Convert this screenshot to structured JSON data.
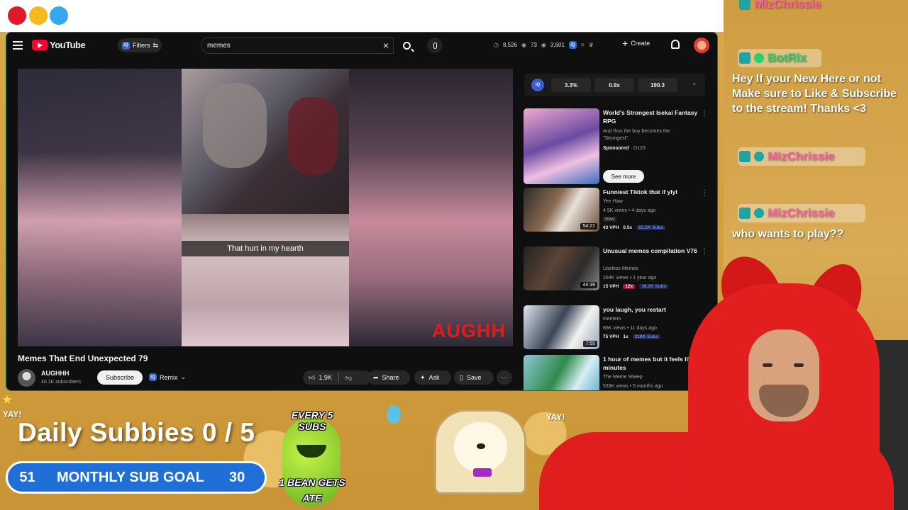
{
  "window_controls": [
    "red",
    "yellow",
    "blue"
  ],
  "youtube": {
    "logo_text": "YouTube",
    "filters_label": "Filters",
    "search": {
      "value": "memes"
    },
    "stats": {
      "views": "8,526",
      "watching": "73",
      "viewers": "3,601"
    },
    "create_label": "Create",
    "player": {
      "caption": "That hurt in my hearth",
      "watermark": "AUGHH"
    },
    "video_title": "Memes That End Unexpected 79",
    "channel": {
      "name": "AUGHHH",
      "subs": "40.1K subscribers"
    },
    "subscribe_label": "Subscribe",
    "remix_label": "Remix",
    "actions": {
      "likes": "1.9K",
      "share": "Share",
      "ask": "Ask",
      "save": "Save"
    },
    "iq_stats": [
      "3.3%",
      "0.9x",
      "190.3"
    ],
    "recommendations": [
      {
        "title": "World's Strongest Isekai Fantasy RPG",
        "line1": "And thus the boy becomes the \"Strongest\".",
        "sponsored": "Sponsored",
        "sponsor": "G123",
        "button": "See more"
      },
      {
        "title": "Funniest Tiktok that if ylyl",
        "channel": "Yee Haw",
        "meta": "4.5K views • 4 days ago",
        "tag": "New",
        "duration": "54:21",
        "vph": "43 VPH",
        "mult": "0.5x",
        "subs": "23.5K Subs"
      },
      {
        "title": "Unusual memes compilation V76",
        "channel": "Useless Memes",
        "meta": "164K views • 1 year ago",
        "duration": "44:39",
        "vph": "15 VPH",
        "mult": "12x",
        "subs": "16.2K Subs"
      },
      {
        "title": "you laugh, you restart",
        "channel": "memem",
        "meta": "66K views • 11 days ago",
        "duration": "7:55",
        "vph": "75 VPH",
        "mult": "1x",
        "subs": "218K Subs"
      },
      {
        "title": "1 hour of memes but it feels like 3 minutes",
        "channel": "The Meme Sheep",
        "meta": "533K views • 5 months ago"
      }
    ]
  },
  "chat": {
    "messages": [
      {
        "user": "MizChrissie",
        "text": ""
      },
      {
        "user": "BotRix",
        "text": "Hey If your New Here or not Make sure to Like & Subscribe to the stream! Thanks <3"
      },
      {
        "user": "MizChrissie",
        "text": ""
      },
      {
        "user": "MizChrissie",
        "text": "who wants to play??"
      }
    ]
  },
  "overlay": {
    "daily_subbies": "Daily Subbies 0 / 5",
    "goal": {
      "current": "51",
      "label": "MONTHLY SUB GOAL",
      "target": "30"
    },
    "bean_top": "EVERY 5 SUBS",
    "bean_bottom": "1 BEAN GETS ATE",
    "yay": "YAY!"
  },
  "colors": {
    "youtube_red": "#ff0033",
    "botrix_green": "#24d36a",
    "mizchrissie_pink": "#ff5fa2",
    "goal_blue": "#1f6fd6"
  }
}
